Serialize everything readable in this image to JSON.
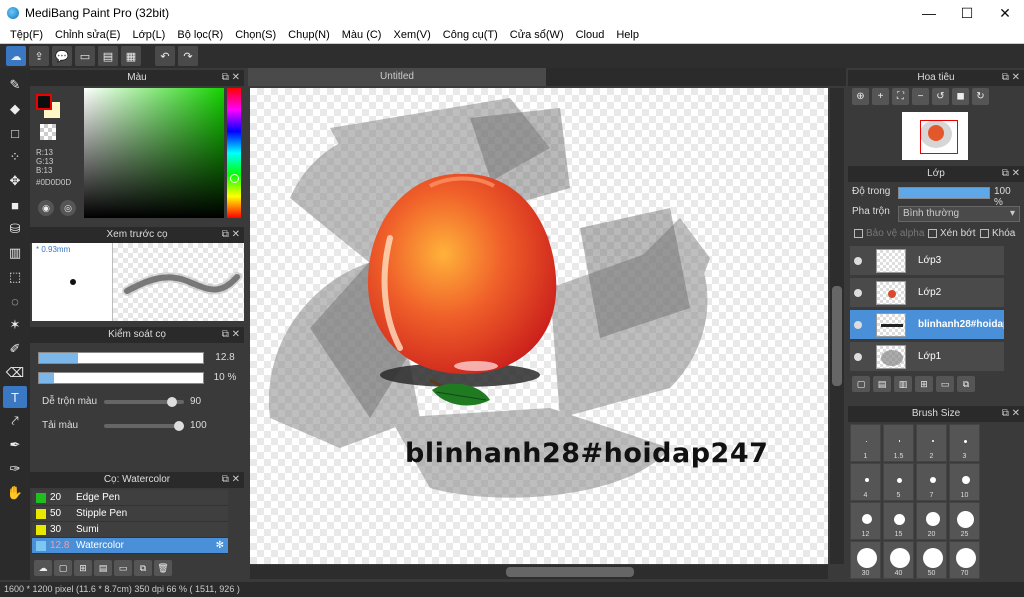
{
  "window": {
    "title": "MediBang Paint Pro (32bit)",
    "controls": [
      "—",
      "☐",
      "✕"
    ]
  },
  "menu": [
    "Tệp(F)",
    "Chỉnh sửa(E)",
    "Lớp(L)",
    "Bộ lọc(R)",
    "Chọn(S)",
    "Chụp(N)",
    "Màu (C)",
    "Xem(V)",
    "Công cụ(T)",
    "Cửa sổ(W)",
    "Cloud",
    "Help"
  ],
  "toolbar_icons": [
    "cloud-icon",
    "export-icon",
    "comment-icon",
    "text-bubble-icon",
    "panel-icon",
    "grid-icon",
    "undo-icon",
    "redo-icon"
  ],
  "tools": [
    "brush-icon",
    "eraser-icon",
    "rectangle-icon",
    "dot-brush-icon",
    "move-icon",
    "fill-rect-icon",
    "bucket-icon",
    "gradient-icon",
    "select-rect-icon",
    "lasso-icon",
    "magic-wand-icon",
    "select-pen-icon",
    "select-eraser-icon",
    "text-icon",
    "operation-icon",
    "eyedropper-icon",
    "pen-tool-icon",
    "hand-icon"
  ],
  "color_panel": {
    "title": "Màu",
    "rgb": [
      "R:13",
      "G:13",
      "B:13"
    ],
    "hex": "#0D0D0D",
    "fg_color": "#0d0d0d",
    "bg_color": "#fff6c8"
  },
  "brush_preview": {
    "title": "Xem trước cọ",
    "size": "* 0.93mm"
  },
  "brush_control": {
    "title": "Kiểm soát cọ",
    "size_value": "12.8",
    "size_fraction": 0.24,
    "opacity_value": "10 %",
    "opacity_fraction": 0.09,
    "mix_label": "Dễ trộn màu",
    "mix_value": "90",
    "mix_fraction": 0.9,
    "load_label": "Tải màu",
    "load_value": "100",
    "load_fraction": 1.0
  },
  "brush_list": {
    "title": "Cọ: Watercolor",
    "items": [
      {
        "size": "20",
        "name": "Edge Pen",
        "color": "#1fbf1f"
      },
      {
        "size": "50",
        "name": "Stipple Pen",
        "color": "#e8e800"
      },
      {
        "size": "30",
        "name": "Sumi",
        "color": "#e8e800"
      },
      {
        "size": "12.8",
        "name": "Watercolor",
        "color": "#7cc8f0",
        "selected": true
      }
    ]
  },
  "canvas": {
    "tab": "Untitled",
    "stamp_text": "blinhanh28#hoidap247"
  },
  "navigator": {
    "title": "Hoa tiêu"
  },
  "layers": {
    "title": "Lớp",
    "opacity_label": "Độ trong",
    "opacity_value": "100 %",
    "blend_label": "Pha trộn",
    "blend_value": "Bình thường",
    "protect_alpha": "Bảo vệ alpha",
    "clipping": "Xén bớt",
    "lock": "Khóa",
    "items": [
      {
        "name": "Lớp3"
      },
      {
        "name": "Lớp2"
      },
      {
        "name": "blinhanh28#hoidap247",
        "selected": true
      },
      {
        "name": "Lớp1"
      }
    ]
  },
  "brush_size": {
    "title": "Brush Size",
    "sizes": [
      "1",
      "1.5",
      "2",
      "3",
      "4",
      "5",
      "7",
      "10",
      "12",
      "15",
      "20",
      "25",
      "30",
      "40",
      "50",
      "70"
    ]
  },
  "status": "1600 * 1200 pixel    (11.6 * 8.7cm)   350 dpi   66 %    ( 1511, 926 )"
}
